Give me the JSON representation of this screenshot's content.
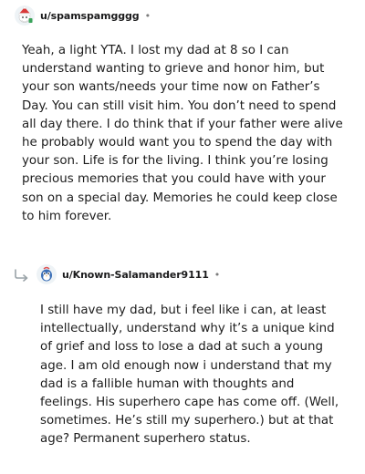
{
  "comments": [
    {
      "username": "u/spamspamgggg",
      "dot": "•",
      "avatar_icon": "santa-snoo-avatar-icon",
      "text": "Yeah, a light YTA. I lost my dad at 8 so I can\nunderstand wanting to grieve and honor him, but\nyour son wants/needs your time now on Father’s\nDay. You can still visit him. You don’t need to spend\nall day there. I do think that if your father were alive\nhe probably would want you to spend the day with\nyour son. Life is for the living. I think you’re losing\nprecious memories that you could have with your\nson on a special day. Memories he could keep close\nto him forever."
    },
    {
      "username": "u/Known-Salamander9111",
      "dot": "•",
      "avatar_icon": "blue-bird-snoo-avatar-icon",
      "reply_icon": "reply-arrow-icon",
      "text": "I still have my dad, but i feel like i can, at least\nintellectually, understand why it’s a unique kind\nof grief and loss to lose a dad at such a young\nage. I am old enough now i understand that my\ndad is a fallible human with thoughts and\nfeelings. His superhero cape has come off. (Well,\nsometimes. He’s still my superhero.) but at that\nage? Permanent superhero status."
    }
  ]
}
